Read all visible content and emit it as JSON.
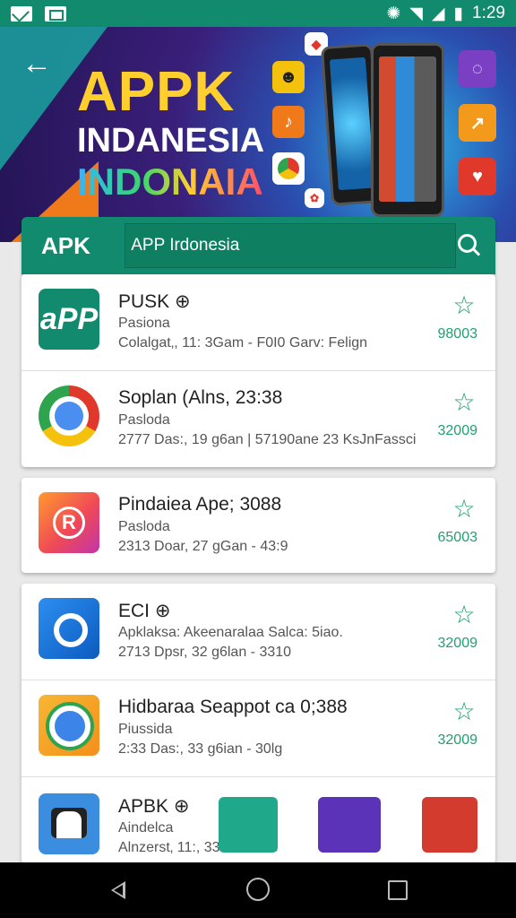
{
  "status": {
    "time": "1:29"
  },
  "banner": {
    "line1": "APPK",
    "line2": "INDANESIA",
    "line3": "INDONAIA"
  },
  "search": {
    "brand": "APK",
    "value": "APP Irdonesia"
  },
  "apps": [
    {
      "name": "PUSK ⊕",
      "sub": "Pasiona",
      "meta": "Colalgat‚, 11: 3Gam  -  F0I0 Garv: Felign",
      "count": "98003",
      "icon": "app-logo-icon"
    },
    {
      "name": "Soplan (Alns, 23:38",
      "sub": "Pasloda",
      "meta": "2777 Das:, 19 g6an | 57190ane 23 KsJnFassci",
      "count": "32009",
      "icon": "chrome-icon"
    },
    {
      "name": "Pindaiea Ape; 3088",
      "sub": "Pasloda",
      "meta": "2313 Doar, 27  gGan  -  43:9",
      "count": "65003",
      "icon": "registered-icon"
    },
    {
      "name": "ECI ⊕",
      "sub": "Apklaksa: Akeenaralaa Salca: 5iao.",
      "meta": "2713 Dpsr, 32  g6lan  -  3310",
      "count": "32009",
      "icon": "blue-target-icon"
    },
    {
      "name": "Hidbaraa Seappot ca 0;388",
      "sub": "Piussida",
      "meta": "2:33 Das:, 33  g6ian  -  30lg",
      "count": "32009",
      "icon": "chrome-orange-icon"
    },
    {
      "name": "APBK ⊕",
      "sub": "Aindelca",
      "meta": "Alnzerst‚ 11:, 33            m         Ta      ms",
      "count": "",
      "icon": "robot-icon"
    }
  ]
}
